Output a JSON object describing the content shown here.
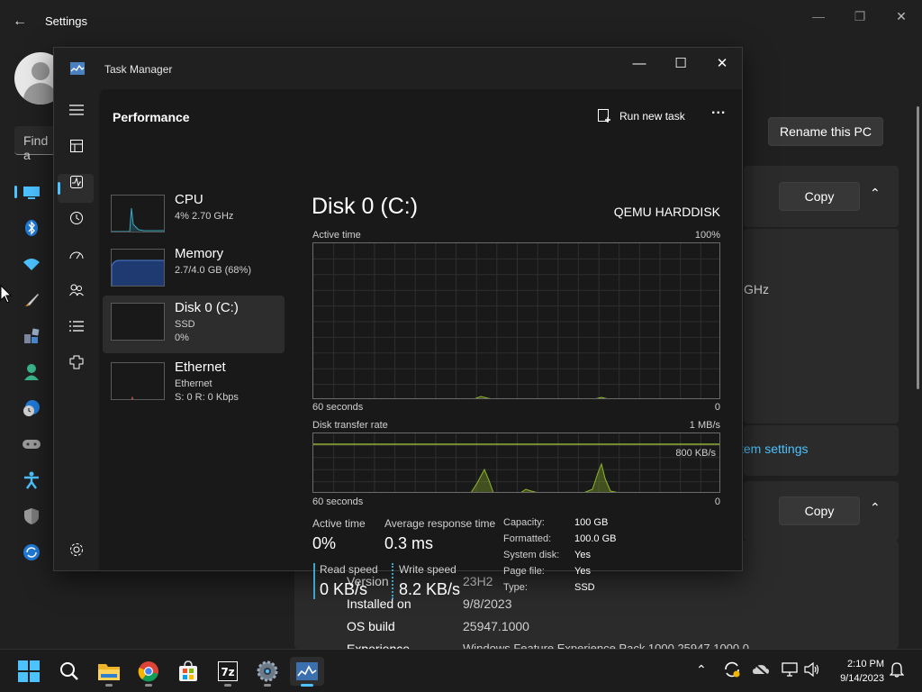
{
  "settings": {
    "title": "Settings",
    "search_placeholder": "Find a",
    "rename_button": "Rename this PC",
    "copy_button_1": "Copy",
    "copy_button_2": "Copy",
    "partial_ghz": "GHz",
    "system_settings_link": "tem settings",
    "info": [
      {
        "label": "Version",
        "value": "23H2"
      },
      {
        "label": "Installed on",
        "value": "9/8/2023"
      },
      {
        "label": "OS build",
        "value": "25947.1000"
      },
      {
        "label": "Experience",
        "value": "Windows Feature Experience Pack 1000.25947.1000.0"
      }
    ],
    "nav_icons": [
      "system-icon",
      "bluetooth-icon",
      "wifi-icon",
      "personalization-icon",
      "apps-icon",
      "accounts-icon",
      "time-language-icon",
      "gaming-icon",
      "accessibility-icon",
      "privacy-icon",
      "windows-update-icon"
    ]
  },
  "task_manager": {
    "title": "Task Manager",
    "section": "Performance",
    "run_new_task": "Run new task",
    "more": "...",
    "items": [
      {
        "name": "CPU",
        "line1": "4%  2.70 GHz",
        "line2": ""
      },
      {
        "name": "Memory",
        "line1": "2.7/4.0 GB (68%)",
        "line2": ""
      },
      {
        "name": "Disk 0 (C:)",
        "line1": "SSD",
        "line2": "0%"
      },
      {
        "name": "Ethernet",
        "line1": "Ethernet",
        "line2": "S: 0  R: 0 Kbps"
      }
    ],
    "detail": {
      "title": "Disk 0 (C:)",
      "model": "QEMU HARDDISK",
      "graph1": {
        "label": "Active time",
        "max": "100%",
        "xlabel": "60 seconds",
        "min": "0"
      },
      "graph2": {
        "label": "Disk transfer rate",
        "max": "1 MB/s",
        "mid": "800 KB/s",
        "xlabel": "60 seconds",
        "min": "0"
      },
      "stats": {
        "active_time_label": "Active time",
        "active_time_value": "0%",
        "avg_resp_label": "Average response time",
        "avg_resp_value": "0.3 ms",
        "read_label": "Read speed",
        "read_value": "0 KB/s",
        "write_label": "Write speed",
        "write_value": "8.2 KB/s"
      },
      "props": [
        {
          "k": "Capacity:",
          "v": "100 GB"
        },
        {
          "k": "Formatted:",
          "v": "100.0 GB"
        },
        {
          "k": "System disk:",
          "v": "Yes"
        },
        {
          "k": "Page file:",
          "v": "Yes"
        },
        {
          "k": "Type:",
          "v": "SSD"
        }
      ]
    }
  },
  "taskbar": {
    "time": "2:10 PM",
    "date": "9/14/2023",
    "apps": [
      "start-icon",
      "search-icon",
      "file-explorer-icon",
      "chrome-icon",
      "store-icon",
      "7zip-icon",
      "settings-icon",
      "task-manager-icon"
    ]
  },
  "colors": {
    "accent": "#4cc2ff",
    "disk_graph": "#8fb62a"
  }
}
